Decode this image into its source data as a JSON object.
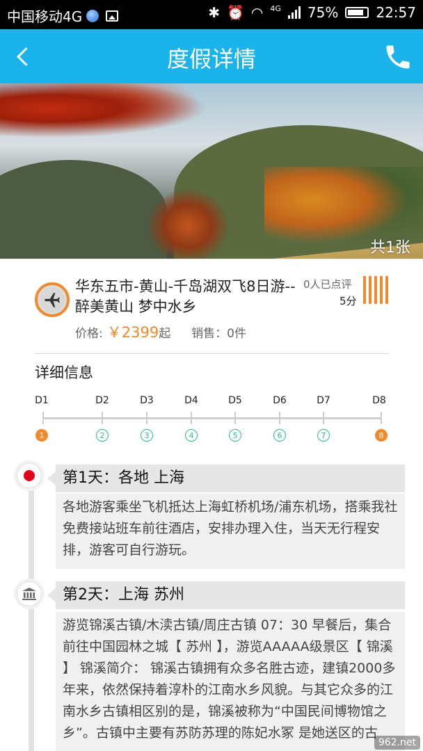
{
  "status_bar": {
    "carrier": "中国移动4G",
    "network_type": "4G",
    "battery": "75%",
    "time": "22:57"
  },
  "header": {
    "title": "度假详情"
  },
  "banner": {
    "photo_count": "共1张"
  },
  "product": {
    "name": "华东五市-黄山-千岛湖双飞8日游--醉美黄山 梦中水乡",
    "rating_count": "0人已点评",
    "rating_score": "5分",
    "price_label": "价格:",
    "price_value": "￥2399",
    "price_suffix": "起",
    "sales": "销售：0件"
  },
  "details": {
    "title": "详细信息",
    "days": [
      {
        "label": "D1",
        "num": "1",
        "active": true
      },
      {
        "label": "D2",
        "num": "2",
        "active": false
      },
      {
        "label": "D3",
        "num": "3",
        "active": false
      },
      {
        "label": "D4",
        "num": "4",
        "active": false
      },
      {
        "label": "D5",
        "num": "5",
        "active": false
      },
      {
        "label": "D6",
        "num": "6",
        "active": false
      },
      {
        "label": "D7",
        "num": "7",
        "active": false
      },
      {
        "label": "D8",
        "num": "8",
        "active": true
      }
    ]
  },
  "itinerary": [
    {
      "title": "第1天：各地 上海",
      "body": "各地游客乘坐飞机抵达上海虹桥机场/浦东机场，搭乘我社免费接站班车前往酒店，安排办理入住，当天无行程安排，游客可自行游玩。"
    },
    {
      "title": "第2天：上海 苏州",
      "body": "游览锦溪古镇/木渎古镇/周庄古镇 07：30 早餐后，集合前往中国园林之城【 苏州 】，游览AAAAA级景区【 锦溪 】 锦溪简介： 锦溪古镇拥有众多名胜古迹，建镇2000多年来，依然保持着淳朴的江南水乡风貌。与其它众多的江南水乡古镇相区别的是，锦溪被称为“中国民间博物馆之乡”。古镇中主要有苏防苏理的陈妃水冢 是她送区的古"
    }
  ],
  "watermark": "962.net"
}
